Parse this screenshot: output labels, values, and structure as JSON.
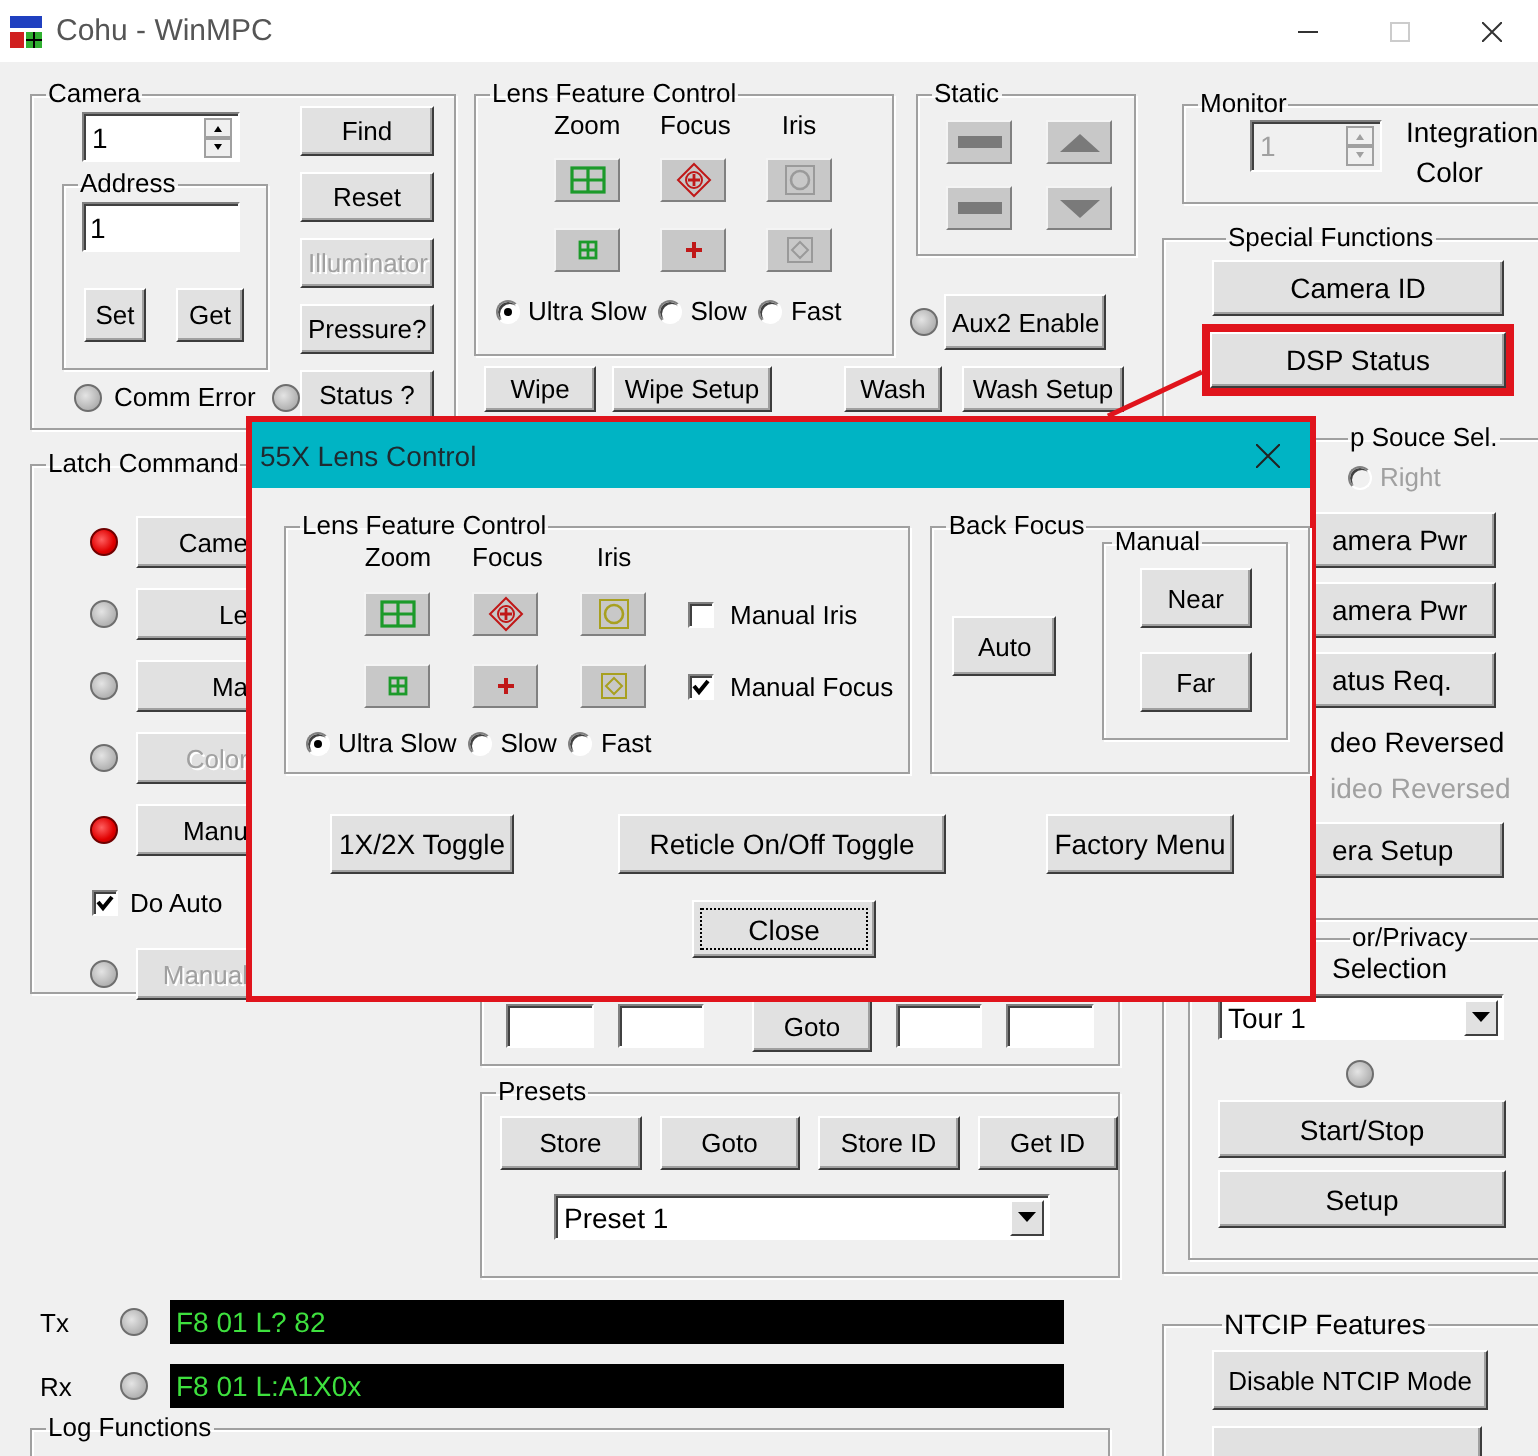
{
  "window": {
    "title": "Cohu - WinMPC"
  },
  "camera": {
    "title": "Camera",
    "number": "1",
    "address": {
      "title": "Address",
      "value": "1",
      "buttons": [
        "Set",
        "Get"
      ]
    },
    "comm_error": {
      "label": "Comm Error",
      "on": false
    },
    "status_led": {
      "on": false
    },
    "buttons": [
      {
        "label": "Find",
        "disabled": false
      },
      {
        "label": "Reset",
        "disabled": false
      },
      {
        "label": "Illuminator",
        "disabled": true
      },
      {
        "label": "Pressure?",
        "disabled": false
      },
      {
        "label": "Status ?",
        "disabled": false
      }
    ]
  },
  "latch_commands": {
    "title": "Latch Command",
    "rows": [
      {
        "kind": "button",
        "label": "Came",
        "on": true,
        "disabled": false
      },
      {
        "kind": "button",
        "label": "Le",
        "on": false,
        "disabled": false
      },
      {
        "kind": "button",
        "label": "Ma",
        "on": false,
        "disabled": false
      },
      {
        "kind": "button",
        "label": "Color",
        "on": false,
        "disabled": true
      },
      {
        "kind": "button",
        "label": "Manu",
        "on": true,
        "disabled": false
      },
      {
        "kind": "checkbox",
        "label": "Do Auto",
        "checked": true
      },
      {
        "kind": "button",
        "label": "Manual",
        "on": false,
        "disabled": true
      }
    ]
  },
  "lens_feature_control": {
    "title": "Lens Feature Control",
    "columns": [
      {
        "label": "Zoom",
        "disabled": false
      },
      {
        "label": "Focus",
        "disabled": false
      },
      {
        "label": "Iris",
        "disabled": true
      }
    ],
    "speeds": [
      {
        "label": "Ultra Slow",
        "selected": true
      },
      {
        "label": "Slow",
        "selected": false
      },
      {
        "label": "Fast",
        "selected": false
      }
    ]
  },
  "static": {
    "title": "Static"
  },
  "aux2": {
    "label": "Aux2 Enable",
    "on": false
  },
  "wipe_wash": [
    "Wipe",
    "Wipe Setup",
    "Wash",
    "Wash Setup"
  ],
  "position_row": {
    "button": "Goto"
  },
  "presets": {
    "title": "Presets",
    "buttons": [
      "Store",
      "Goto",
      "Store ID",
      "Get ID"
    ],
    "selection": "Preset 1"
  },
  "monitor": {
    "title": "Monitor",
    "number": "1",
    "labels": [
      "Integration",
      "Color"
    ]
  },
  "special_functions": {
    "title": "Special Functions",
    "buttons": [
      {
        "label": "Camera ID",
        "highlighted": false
      },
      {
        "label": "DSP Status",
        "highlighted": true
      }
    ],
    "video_source": {
      "title": "p Souce Sel.",
      "radios": [
        {
          "label": "Right",
          "selected": false
        }
      ],
      "items": [
        {
          "kind": "button",
          "label": "amera Pwr"
        },
        {
          "kind": "button",
          "label": "amera Pwr"
        },
        {
          "kind": "button",
          "label": "atus Req."
        },
        {
          "kind": "text",
          "label": "deo Reversed",
          "disabled": false
        },
        {
          "kind": "text",
          "label": "ideo Reversed",
          "disabled": true
        },
        {
          "kind": "button",
          "label": "era Setup"
        }
      ]
    },
    "tour": {
      "title": "or/Privacy",
      "label": "Selection",
      "selection": "Tour 1",
      "on": false,
      "buttons": [
        "Start/Stop",
        "Setup"
      ]
    }
  },
  "log": [
    {
      "label": "Tx",
      "on": false,
      "text": "F8 01 L? 82"
    },
    {
      "label": "Rx",
      "on": false,
      "text": "F8 01 L:A1X0x"
    }
  ],
  "log_functions": {
    "title": "Log Functions"
  },
  "ntcip": {
    "title": "NTCIP Features",
    "buttons": [
      "Disable NTCIP Mode"
    ]
  },
  "dialog": {
    "title": "55X Lens Control",
    "lens_feature_control": {
      "title": "Lens Feature Control",
      "columns": [
        {
          "label": "Zoom",
          "disabled": false
        },
        {
          "label": "Focus",
          "disabled": false
        },
        {
          "label": "Iris",
          "disabled": false
        }
      ],
      "checks": [
        {
          "label": "Manual Iris",
          "checked": false
        },
        {
          "label": "Manual Focus",
          "checked": true
        }
      ],
      "speeds": [
        {
          "label": "Ultra Slow",
          "selected": true
        },
        {
          "label": "Slow",
          "selected": false
        },
        {
          "label": "Fast",
          "selected": false
        }
      ]
    },
    "back_focus": {
      "title": "Back Focus",
      "button": "Auto",
      "manual": {
        "title": "Manual",
        "buttons": [
          "Near",
          "Far"
        ]
      }
    },
    "buttons": [
      "1X/2X Toggle",
      "Reticle On/Off Toggle",
      "Factory Menu"
    ],
    "close": {
      "label": "Close",
      "focused": true
    }
  }
}
